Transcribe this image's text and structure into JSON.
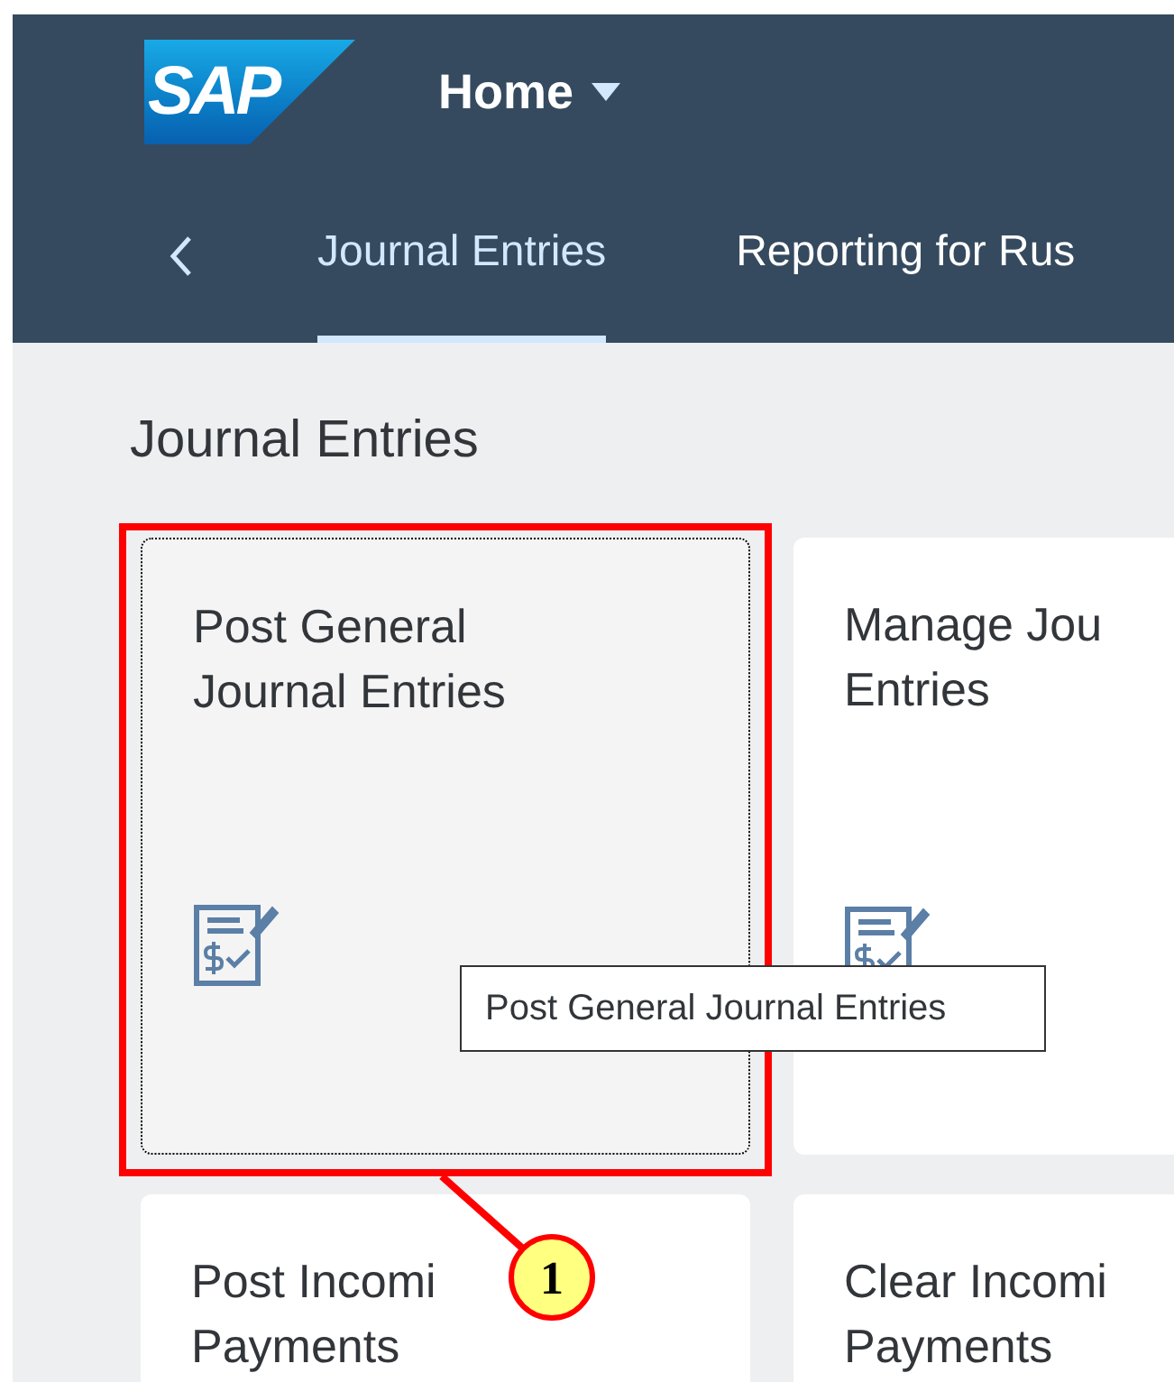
{
  "header": {
    "logo": "SAP",
    "title": "Home",
    "tabs": [
      {
        "label": "Journal Entries",
        "selected": true
      },
      {
        "label": "Reporting for Rus",
        "selected": false
      }
    ]
  },
  "section": {
    "title": "Journal Entries",
    "tiles": [
      {
        "title_lines": [
          "Post General",
          "Journal Entries"
        ],
        "focused": true,
        "has_icon": true
      },
      {
        "title_lines": [
          "Manage Jou",
          "Entries"
        ],
        "focused": false,
        "has_icon": true
      },
      {
        "title_lines": [
          "Post Incomi",
          "Payments"
        ],
        "focused": false,
        "has_icon": false
      },
      {
        "title_lines": [
          "Clear Incomi",
          "Payments"
        ],
        "focused": false,
        "has_icon": false
      }
    ]
  },
  "tooltip": {
    "text": "Post General Journal Entries"
  },
  "callout": {
    "number": "1"
  }
}
